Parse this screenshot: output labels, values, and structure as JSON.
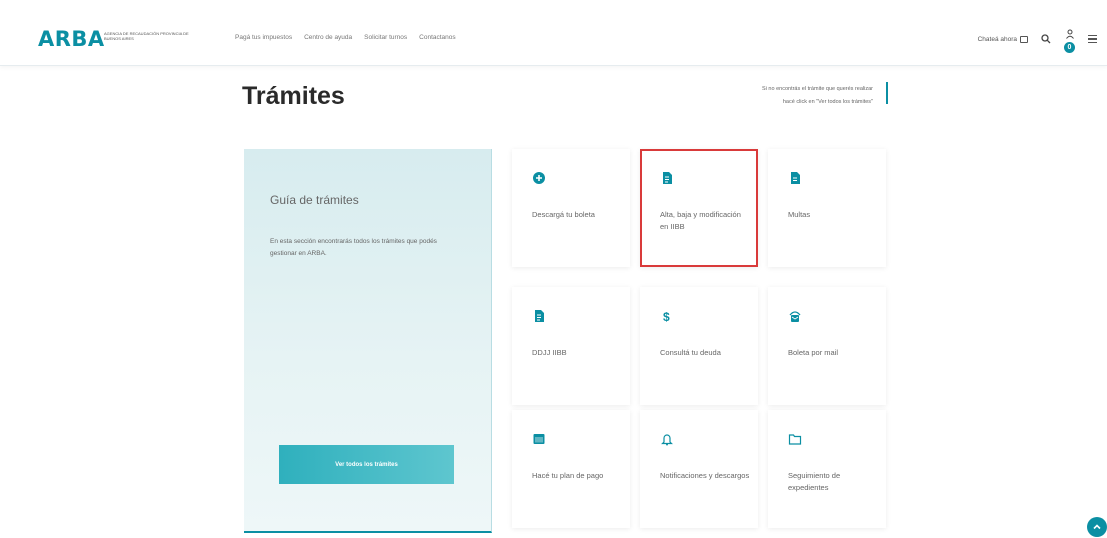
{
  "header": {
    "logo": "ARBA",
    "logo_sub": "AGENCIA DE RECAUDACIÓN PROVINCIA DE BUENOS AIRES",
    "nav": [
      "Pagá tus impuestos",
      "Centro de ayuda",
      "Solicitar turnos",
      "Contactanos"
    ],
    "chat_label": "Chateá ahora",
    "notification_count": "0"
  },
  "page": {
    "title": "Trámites",
    "help_line1": "Si no encontrás el trámite que querés realizar",
    "help_line2": "hacé click en \"Ver todos los trámites\""
  },
  "guide": {
    "title": "Guía de trámites",
    "text": "En esta sección encontrarás todos los trámites que podés gestionar en ARBA.",
    "button": "Ver todos los trámites"
  },
  "cards": [
    {
      "label": "Descargá tu boleta",
      "icon": "plus-circle-icon"
    },
    {
      "label": "Alta, baja y modificación en IIBB",
      "icon": "document-icon"
    },
    {
      "label": "Multas",
      "icon": "file-icon"
    },
    {
      "label": "DDJJ IIBB",
      "icon": "document-icon"
    },
    {
      "label": "Consultá tu deuda",
      "icon": "dollar-icon"
    },
    {
      "label": "Boleta por mail",
      "icon": "mail-icon"
    },
    {
      "label": "Hacé tu plan de pago",
      "icon": "calendar-icon"
    },
    {
      "label": "Notificaciones y descargos",
      "icon": "bell-icon"
    },
    {
      "label": "Seguimiento de expedientes",
      "icon": "folder-icon"
    }
  ],
  "colors": {
    "accent": "#0b8fa3",
    "highlight": "#d93a3a"
  }
}
